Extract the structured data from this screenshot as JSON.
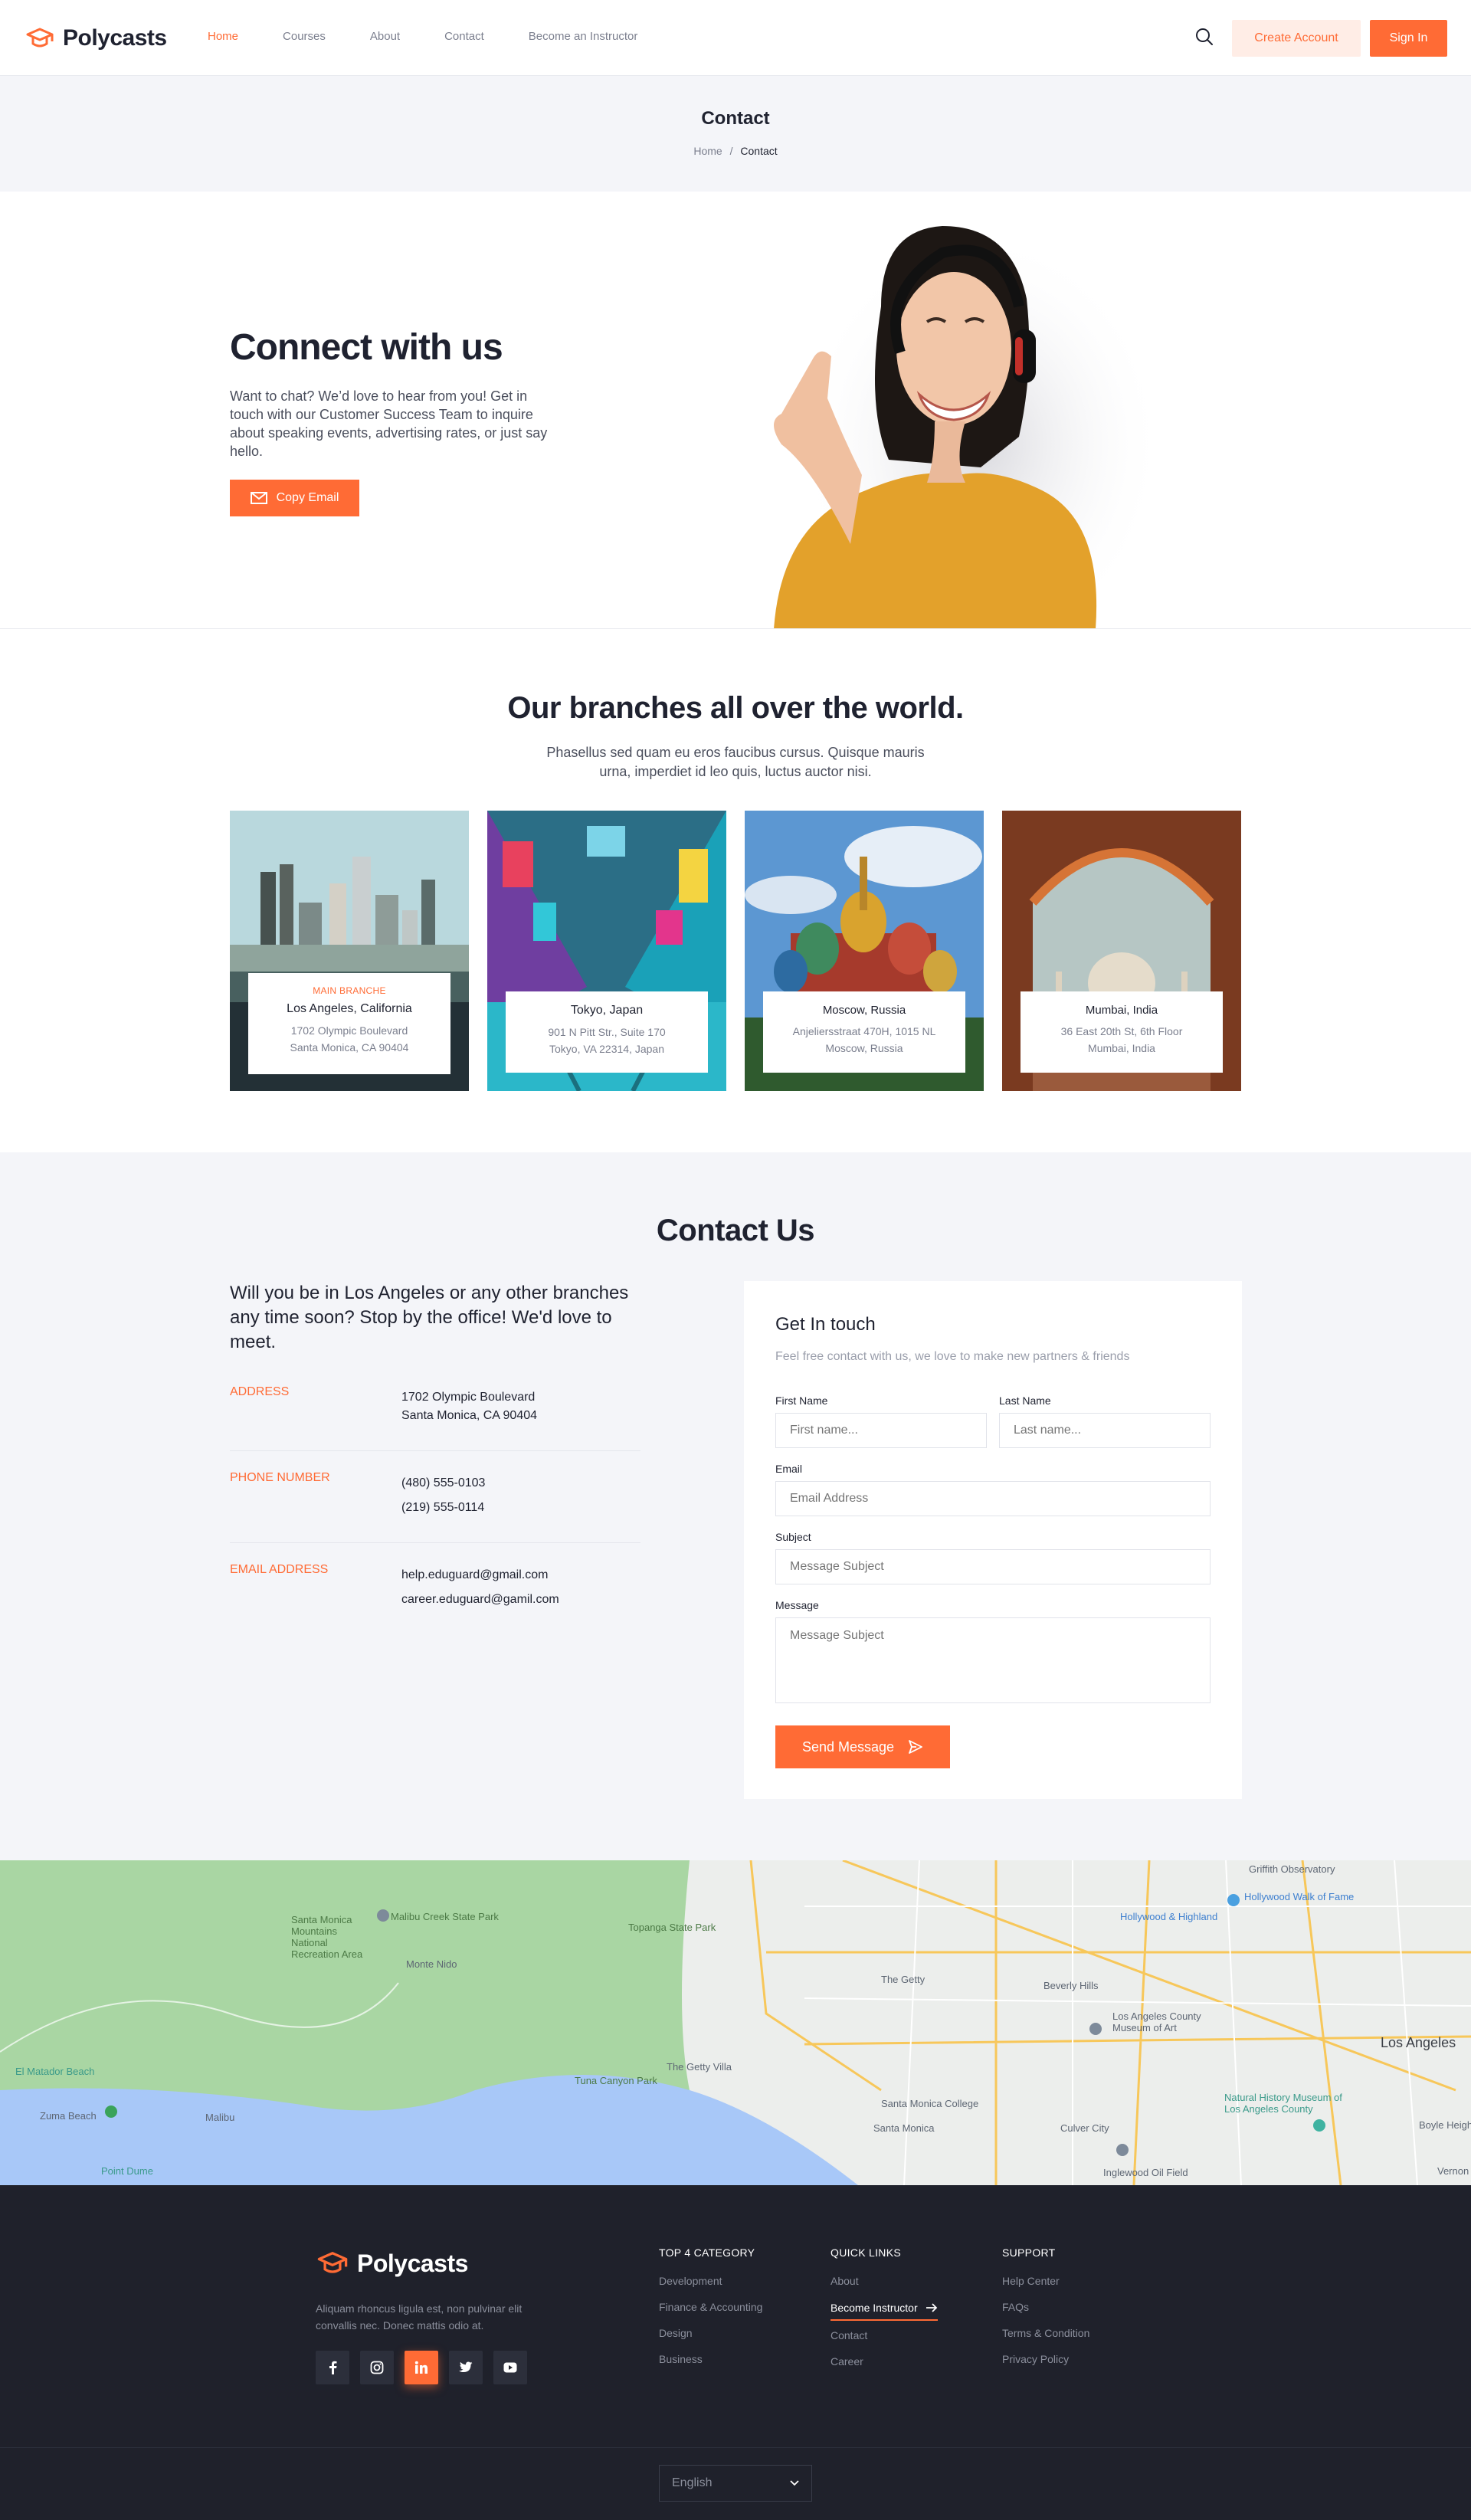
{
  "header": {
    "logo": "Polycasts",
    "nav": [
      "Home",
      "Courses",
      "About",
      "Contact",
      "Become an Instructor"
    ],
    "create_account": "Create Account",
    "sign_in": "Sign In"
  },
  "page_title": {
    "title": "Contact",
    "breadcrumb_home": "Home",
    "breadcrumb_sep": "/",
    "breadcrumb_current": "Contact"
  },
  "hero": {
    "title": "Connect with us",
    "text": "Want to chat? We’d love to hear from you! Get in touch with our Customer Success Team to inquire about speaking events, advertising rates, or just say hello.",
    "copy_email": "Copy Email"
  },
  "branches": {
    "title": "Our branches all over the world.",
    "subtitle": "Phasellus sed quam eu eros faucibus cursus. Quisque mauris urna, imperdiet id leo quis, luctus auctor nisi.",
    "items": [
      {
        "tag": "Main Branche",
        "city": "Los Angeles, California",
        "addr1": "1702 Olympic Boulevard",
        "addr2": "Santa Monica, CA 90404"
      },
      {
        "tag": "",
        "city": "Tokyo, Japan",
        "addr1": "901 N Pitt Str., Suite 170",
        "addr2": "Tokyo, VA 22314, Japan"
      },
      {
        "tag": "",
        "city": "Moscow, Russia",
        "addr1": "Anjeliersstraat 470H, 1015 NL",
        "addr2": "Moscow, Russia"
      },
      {
        "tag": "",
        "city": "Mumbai, India",
        "addr1": "36 East 20th St, 6th Floor",
        "addr2": "Mumbai, India"
      }
    ]
  },
  "contact": {
    "title": "Contact Us",
    "intro": "Will you be in Los Angeles or any other branches any time soon? Stop by the office! We'd love to meet.",
    "address_label": "Address",
    "address1": "1702 Olympic Boulevard",
    "address2": "Santa Monica, CA 90404",
    "phone_label": "Phone Number",
    "phone1": "(480) 555-0103",
    "phone2": "(219) 555-0114",
    "email_label": "Email Address",
    "email1": "help.eduguard@gmail.com",
    "email2": "career.eduguard@gamil.com"
  },
  "form": {
    "title": "Get In touch",
    "subtitle": "Feel free contact with us, we love to make new partners & friends",
    "first_name_label": "First Name",
    "first_name_ph": "First name...",
    "last_name_label": "Last Name",
    "last_name_ph": "Last name...",
    "email_label": "Email",
    "email_ph": "Email Address",
    "subject_label": "Subject",
    "subject_ph": "Message Subject",
    "message_label": "Message",
    "message_ph": "Message Subject",
    "send": "Send Message"
  },
  "map": {
    "labels": [
      "Griffith Observatory",
      "Hollywood & Highland",
      "Hollywood Walk of Fame",
      "Santa Monica Mountains National Recreation Area",
      "Malibu Creek State Park",
      "Topanga State Park",
      "Monte Nido",
      "The Getty",
      "Beverly Hills",
      "Los Angeles County Museum of Art",
      "Los Angeles",
      "Tuna Canyon Park",
      "The Getty Villa",
      "Santa Monica College",
      "Santa Monica",
      "Culver City",
      "Natural History Museum of Los Angeles County",
      "Inglewood Oil Field",
      "El Matador Beach",
      "Zuma Beach",
      "Malibu",
      "Point Dume",
      "Boyle Heights",
      "Vernon"
    ]
  },
  "footer": {
    "logo": "Polycasts",
    "desc": "Aliquam rhoncus ligula est, non pulvinar elit convallis nec. Donec mattis odio at.",
    "cols": [
      {
        "title": "Top 4 Category",
        "links": [
          "Development",
          "Finance & Accounting",
          "Design",
          "Business"
        ]
      },
      {
        "title": "Quick Links",
        "links": [
          "About",
          "Become Instructor",
          "Contact",
          "Career"
        ]
      },
      {
        "title": "Support",
        "links": [
          "Help Center",
          "FAQs",
          "Terms & Condition",
          "Privacy Policy"
        ]
      }
    ],
    "language": "English"
  },
  "colors": {
    "accent": "#ff6b35",
    "accent_light": "#ffede6",
    "dark": "#1f212b",
    "bg_light": "#f4f5f9"
  }
}
